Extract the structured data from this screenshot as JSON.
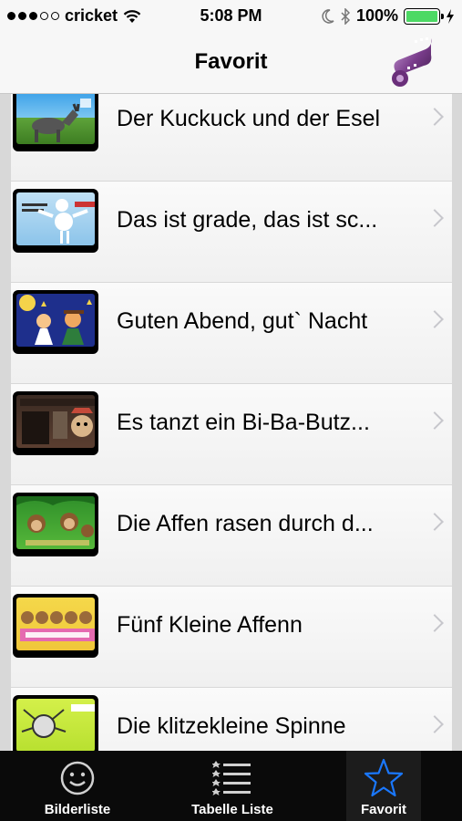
{
  "status_bar": {
    "carrier": "cricket",
    "time": "5:08 PM",
    "battery": "100%",
    "battery_level": 1.0,
    "signal_bars_filled": 3,
    "signal_bars_total": 5
  },
  "nav": {
    "title": "Favorit",
    "film_icon": "film-reel-icon"
  },
  "list": {
    "items": [
      {
        "title": "Der Kuckuck und der Esel"
      },
      {
        "title": "Das ist grade, das ist sc..."
      },
      {
        "title": "Guten Abend, gut` Nacht"
      },
      {
        "title": "Es tanzt ein Bi-Ba-Butz..."
      },
      {
        "title": "Die Affen rasen durch d..."
      },
      {
        "title": "Fünf Kleine Affenn"
      },
      {
        "title": "Die klitzekleine Spinne"
      }
    ]
  },
  "tab_bar": {
    "tabs": [
      {
        "label": "Bilderliste",
        "icon": "smiley-icon"
      },
      {
        "label": "Tabelle Liste",
        "icon": "list-icon"
      },
      {
        "label": "Favorit",
        "icon": "star-icon"
      }
    ],
    "active_color": "#1a78ff"
  }
}
